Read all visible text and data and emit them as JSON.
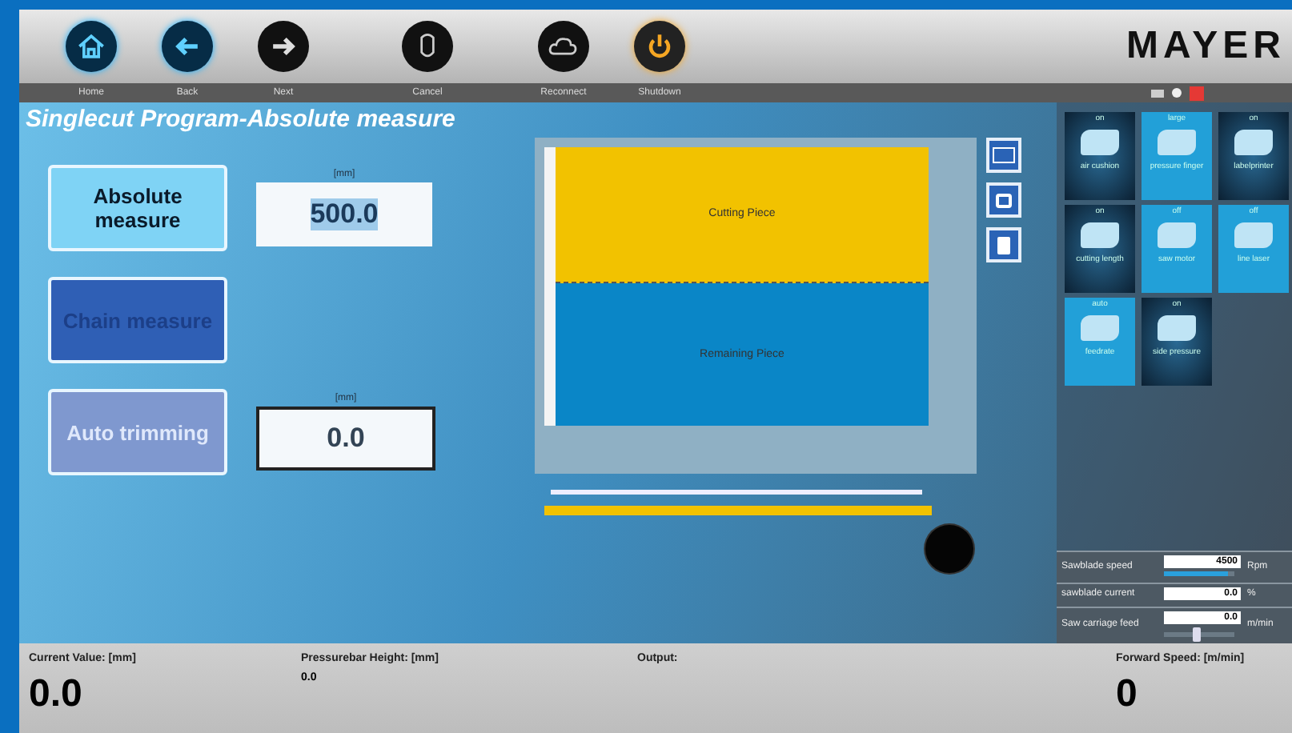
{
  "toolbar": [
    {
      "label": "Home"
    },
    {
      "label": "Back"
    },
    {
      "label": "Next"
    },
    {
      "label": "Cancel"
    },
    {
      "label": "Reconnect"
    },
    {
      "label": "Shutdown"
    }
  ],
  "logo": "MAYER",
  "title": "Singlecut Program-Absolute measure",
  "modes": [
    {
      "label": "Absolute measure",
      "selected": true,
      "disabled": false,
      "unit": "[mm]",
      "value": "500.0"
    },
    {
      "label": "Chain measure",
      "selected": false,
      "disabled": false
    },
    {
      "label": "Auto trimming",
      "selected": false,
      "disabled": true,
      "unit": "[mm]",
      "value": "0.0"
    }
  ],
  "diagram": {
    "top": "Cutting Piece",
    "bottom": "Remaining Piece"
  },
  "tiles": [
    {
      "state": "on",
      "label": "air cushion",
      "active": false
    },
    {
      "state": "large",
      "label": "pressure finger",
      "active": true
    },
    {
      "state": "on",
      "label": "labelprinter",
      "active": false
    },
    {
      "state": "on",
      "label": "cutting length",
      "active": false
    },
    {
      "state": "off",
      "label": "saw motor",
      "active": true
    },
    {
      "state": "off",
      "label": "line laser",
      "active": true
    },
    {
      "state": "auto",
      "label": "feedrate",
      "active": true
    },
    {
      "state": "on",
      "label": "side pressure",
      "active": false
    }
  ],
  "settings": [
    {
      "label": "Sawblade speed",
      "value": "4500",
      "unit": "Rpm",
      "level": 0.9
    },
    {
      "label": "sawblade current",
      "value": "0.0",
      "unit": "%"
    },
    {
      "label": "Saw carriage feed",
      "value": "0.0",
      "unit": "m/min",
      "level": 0.45
    }
  ],
  "footer": [
    {
      "label": "Current Value: [mm]",
      "value": "0.0"
    },
    {
      "label": "Pressurebar Height: [mm]",
      "value": "0.0"
    },
    {
      "label": "Output:"
    },
    {
      "label": "Forward Speed: [m/min]",
      "value": "0"
    }
  ]
}
